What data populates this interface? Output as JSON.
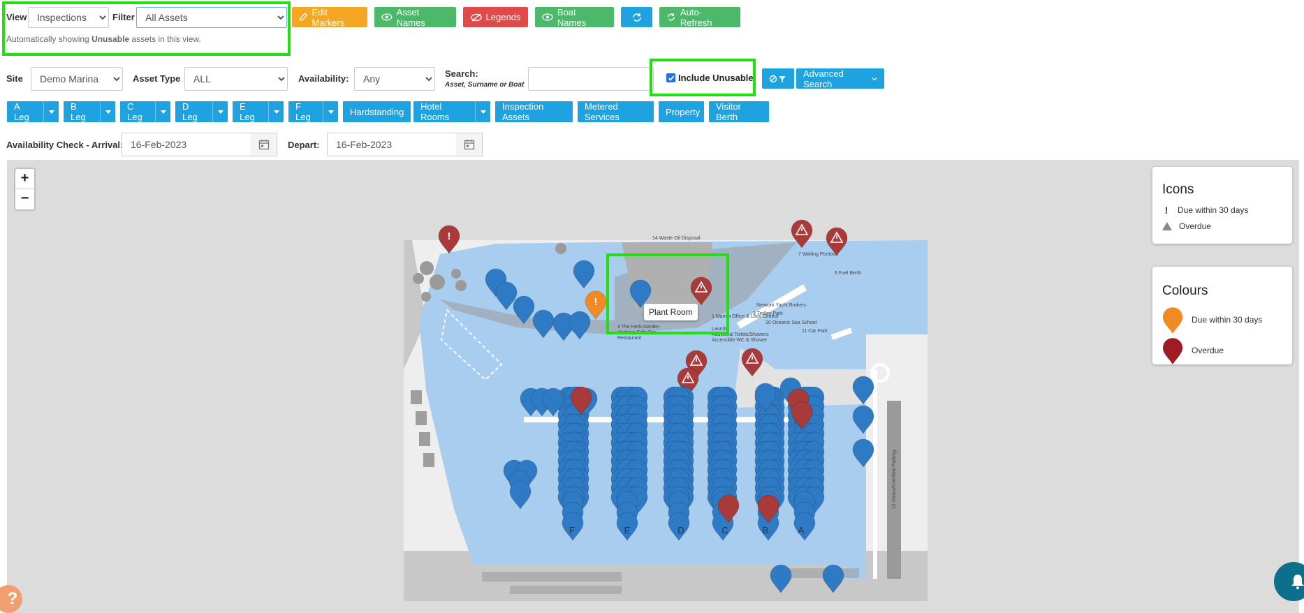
{
  "toolbar": {
    "view_label": "View",
    "view_value": "Inspections",
    "filter_label": "Filter",
    "filter_value": "All Assets",
    "notice_prefix": "Automatically showing ",
    "notice_bold": "Unusable",
    "notice_suffix": " assets in this view.",
    "edit_markers": "Edit Markers",
    "asset_names": "Asset Names",
    "legends": "Legends",
    "boat_names": "Boat Names",
    "auto_refresh": "Auto-Refresh"
  },
  "search_bar": {
    "site_label": "Site",
    "site_value": "Demo Marina",
    "asset_type_label": "Asset Type",
    "asset_type_value": "ALL",
    "availability_label": "Availability:",
    "availability_value": "Any",
    "search_label": "Search:",
    "search_hint": "Asset, Surname or Boat",
    "search_value": "",
    "include_unusable": "Include Unusable",
    "include_unusable_checked": true,
    "advanced_search": "Advanced Search"
  },
  "legs": [
    {
      "label": "A Leg",
      "dropdown": true
    },
    {
      "label": "B Leg",
      "dropdown": true
    },
    {
      "label": "C Leg",
      "dropdown": true
    },
    {
      "label": "D Leg",
      "dropdown": true
    },
    {
      "label": "E Leg",
      "dropdown": true
    },
    {
      "label": "F Leg",
      "dropdown": true
    },
    {
      "label": "Hardstanding",
      "dropdown": false
    },
    {
      "label": "Hotel Rooms",
      "dropdown": true
    },
    {
      "label": "Inspection Assets",
      "dropdown": false
    },
    {
      "label": "Metered Services",
      "dropdown": false
    },
    {
      "label": "Property",
      "dropdown": false
    },
    {
      "label": "Visitor Berth",
      "dropdown": false
    }
  ],
  "availability": {
    "arrival_label": "Availability Check - Arrival:",
    "arrival_value": "16-Feb-2023",
    "depart_label": "Depart:",
    "depart_value": "16-Feb-2023"
  },
  "map": {
    "zoom_in": "+",
    "zoom_out": "−",
    "tooltip": "Plant Room",
    "pontoon_labels": [
      "F",
      "E",
      "D",
      "C",
      "B",
      "A"
    ],
    "place_labels": [
      "14 Waste Oil Disposal",
      "7 Waiting Pontoon",
      "6 Fuel Berth",
      "Network Yacht Brokers",
      "3 Trolley Park",
      "10 Oceanic Sea School",
      "1 Marina Office & Lock Control",
      "Laundry",
      "Additional Toilets/Showers",
      "Accessible WC & Shower",
      "11 Car Park",
      "4 The Herb Garden",
      "Harbour Cafe Bar",
      "Restaurant",
      "12 Visitor/Overflow Parking"
    ]
  },
  "legend_icons": {
    "title": "Icons",
    "due_label": "Due within 30 days",
    "overdue_label": "Overdue"
  },
  "legend_colours": {
    "title": "Colours",
    "due_label": "Due within 30 days",
    "due_color": "#f08a24",
    "overdue_label": "Overdue",
    "overdue_color": "#9e1c24"
  },
  "colors": {
    "marker_blue": "#2f7ac4",
    "marker_red": "#a83a3a",
    "water": "#a9cdef",
    "highlight": "#22e010"
  }
}
